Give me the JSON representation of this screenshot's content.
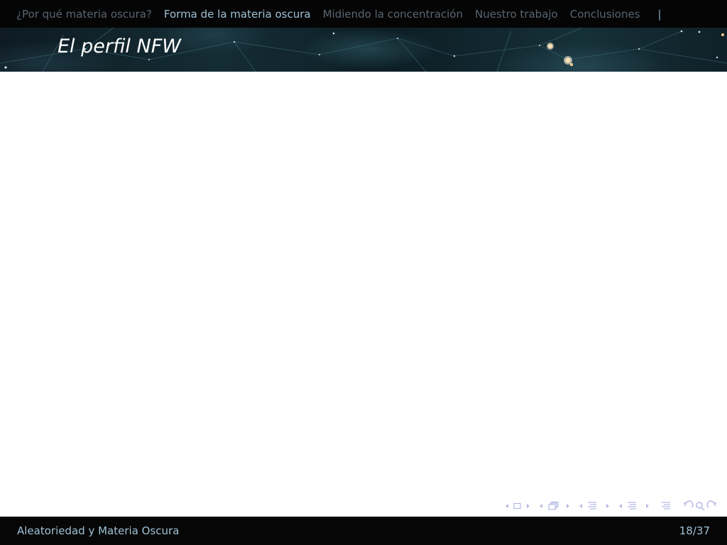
{
  "nav": {
    "items": [
      {
        "label": "¿Por qué materia oscura?",
        "active": false
      },
      {
        "label": "Forma de la materia oscura",
        "active": true
      },
      {
        "label": "Midiendo la concentración",
        "active": false
      },
      {
        "label": "Nuestro trabajo",
        "active": false
      },
      {
        "label": "Conclusiones",
        "active": false
      }
    ],
    "separator": "|"
  },
  "banner": {
    "title": "El perfil NFW"
  },
  "footer": {
    "short_title": "Aleatoriedad y Materia Oscura",
    "page": "18/37"
  },
  "nav_symbols": {
    "icons": [
      "frame-prev-arrow-icon",
      "frame-icon",
      "frame-next-arrow-icon",
      "subsection-prev-arrow-icon",
      "subsection-icon",
      "subsection-next-arrow-icon",
      "section-prev-arrow-icon",
      "section-icon",
      "section-next-arrow-icon",
      "document-prev-arrow-icon",
      "document-icon",
      "document-next-arrow-icon",
      "appendix-icon",
      "back-icon",
      "search-icon",
      "forward-icon"
    ],
    "color": "#b4b9e6"
  },
  "colors": {
    "nav_active": "#9fc2d6",
    "nav_inactive": "#5a6570",
    "bar_background": "#050505",
    "footer_text": "#9fc2d6"
  }
}
